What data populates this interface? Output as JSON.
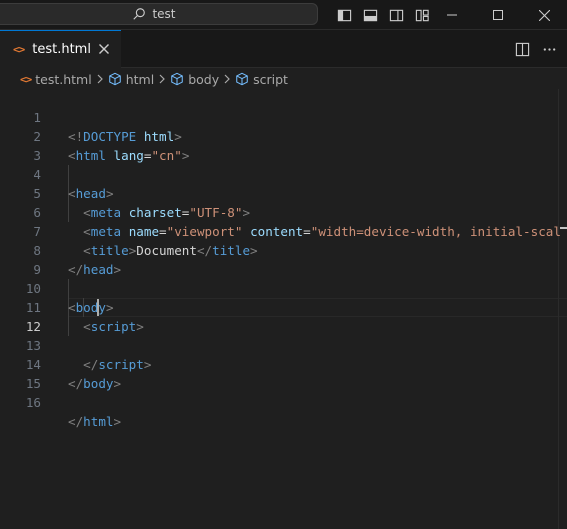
{
  "titlebar": {
    "search_text": "test",
    "icons": [
      "toggle-primary-sidebar-icon",
      "toggle-panel-icon",
      "toggle-secondary-sidebar-icon",
      "customize-layout-icon"
    ],
    "window_controls": [
      "minimize-icon",
      "maximize-icon",
      "close-icon"
    ]
  },
  "tab": {
    "icon_glyph": "<>",
    "label": "test.html"
  },
  "breadcrumb": {
    "file_glyph": "<>",
    "file": "test.html",
    "items": [
      "html",
      "body",
      "script"
    ]
  },
  "editor": {
    "active_line": 12,
    "lines": [
      {
        "num": "1"
      },
      {
        "num": "2"
      },
      {
        "num": "3"
      },
      {
        "num": "4"
      },
      {
        "num": "5"
      },
      {
        "num": "6"
      },
      {
        "num": "7"
      },
      {
        "num": "8"
      },
      {
        "num": "9"
      },
      {
        "num": "10"
      },
      {
        "num": "11"
      },
      {
        "num": "12"
      },
      {
        "num": "13"
      },
      {
        "num": "14"
      },
      {
        "num": "15"
      },
      {
        "num": "16"
      }
    ],
    "code": {
      "l1": {
        "open": "<!",
        "doctype": "DOCTYPE",
        "html": "html",
        "close": ">"
      },
      "l2": {
        "open": "<",
        "tag": "html",
        "attr": "lang",
        "eq": "=",
        "val": "\"cn\"",
        "close": ">"
      },
      "l4": {
        "open": "<",
        "tag": "head",
        "close": ">"
      },
      "l5": {
        "open": "<",
        "tag": "meta",
        "attr": "charset",
        "eq": "=",
        "val": "\"UTF-8\"",
        "close": ">"
      },
      "l6": {
        "open": "<",
        "tag": "meta",
        "attr1": "name",
        "eq1": "=",
        "val1": "\"viewport\"",
        "attr2": "content",
        "eq2": "=",
        "val2": "\"width=device-width, initial-scal"
      },
      "l7": {
        "open": "<",
        "tag": "title",
        "close": ">",
        "text": "Document",
        "endopen": "</",
        "endtag": "title",
        "endclose": ">"
      },
      "l8": {
        "open": "</",
        "tag": "head",
        "close": ">"
      },
      "l10": {
        "open": "<",
        "tag": "body",
        "close": ">"
      },
      "l11": {
        "open": "<",
        "tag": "script",
        "close": ">"
      },
      "l13": {
        "open": "</",
        "tag": "script",
        "close": ">"
      },
      "l14": {
        "open": "</",
        "tag": "body",
        "close": ">"
      },
      "l16": {
        "open": "</",
        "tag": "html",
        "close": ">"
      }
    }
  },
  "colors": {
    "background": "#1f1f1f",
    "tag": "#569cd6",
    "attribute": "#9cdcfe",
    "string": "#ce9178",
    "punctuation": "#808080",
    "html_file_icon": "#e37933"
  }
}
